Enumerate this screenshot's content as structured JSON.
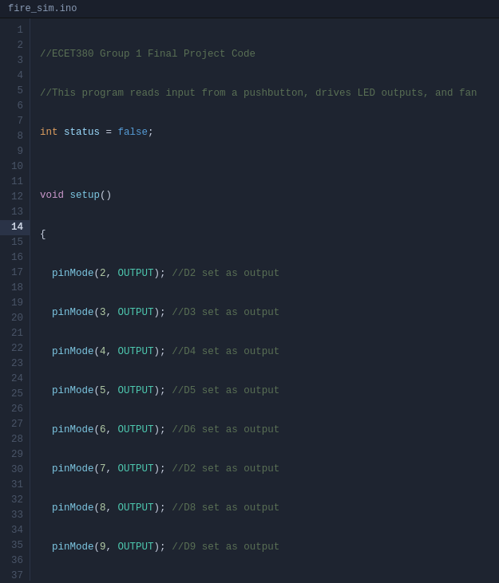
{
  "titleBar": {
    "filename": "fire_sim.ino"
  },
  "editor": {
    "activeLines": [
      14
    ]
  }
}
